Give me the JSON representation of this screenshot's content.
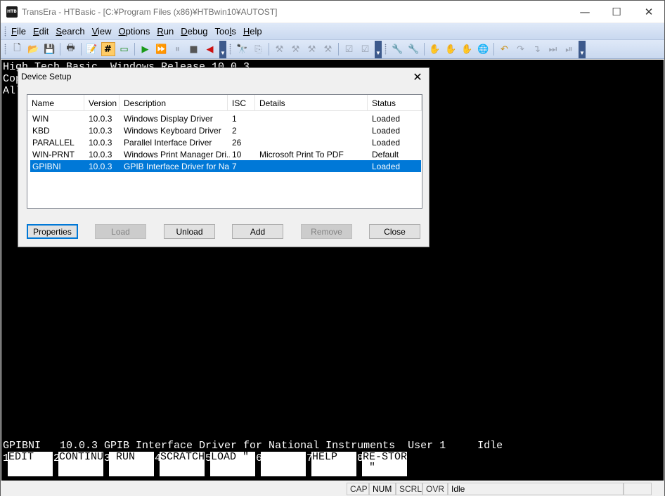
{
  "window": {
    "title": "TransEra - HTBasic - [C:¥Program Files (x86)¥HTBwin10¥AUTOST]",
    "app_icon_text": "HTB"
  },
  "menu": [
    {
      "label": "File",
      "ul": "F",
      "rest": "ile"
    },
    {
      "label": "Edit",
      "ul": "E",
      "rest": "dit"
    },
    {
      "label": "Search",
      "ul": "S",
      "rest": "earch"
    },
    {
      "label": "View",
      "ul": "V",
      "rest": "iew"
    },
    {
      "label": "Options",
      "ul": "O",
      "rest": "ptions"
    },
    {
      "label": "Run",
      "ul": "R",
      "rest": "un"
    },
    {
      "label": "Debug",
      "ul": "D",
      "rest": "ebug"
    },
    {
      "label": "Tools",
      "pre": "Too",
      "ul": "l",
      "rest": "s"
    },
    {
      "label": "Help",
      "ul": "H",
      "rest": "elp"
    }
  ],
  "toolbar": {
    "group1": [
      {
        "name": "new-file-icon",
        "glyph": "🗋",
        "color": "#444444"
      },
      {
        "name": "open-folder-icon",
        "glyph": "📂",
        "color": "#c8901a"
      },
      {
        "name": "save-icon",
        "glyph": "💾",
        "color": "#2b4fa0"
      },
      {
        "name": "print-icon",
        "glyph": "🖶",
        "color": "#444444"
      },
      {
        "name": "edit-program-icon",
        "glyph": "📝",
        "color": "#444444"
      },
      {
        "name": "hash-toggle-icon",
        "glyph": "#",
        "color": "#000000",
        "active": true
      },
      {
        "name": "console-icon",
        "glyph": "▭",
        "color": "#1a8a1a"
      },
      {
        "name": "run-icon",
        "glyph": "▶",
        "color": "#1a9a1a"
      },
      {
        "name": "continue-icon",
        "glyph": "⏩",
        "color": "#9aa3b2"
      },
      {
        "name": "pause-icon",
        "glyph": "⏸",
        "color": "#9aa3b2"
      },
      {
        "name": "stop-icon",
        "glyph": "■",
        "color": "#555555"
      },
      {
        "name": "step-back-icon",
        "glyph": "◀",
        "color": "#cc1111"
      }
    ],
    "group2": [
      {
        "name": "find-icon",
        "glyph": "🔭",
        "color": "#9aa3b2"
      },
      {
        "name": "replace-icon",
        "glyph": "⎘",
        "color": "#9aa3b2"
      },
      {
        "name": "tool-1-icon",
        "glyph": "⚒",
        "color": "#9aa3b2"
      },
      {
        "name": "tool-2-icon",
        "glyph": "⚒",
        "color": "#9aa3b2"
      },
      {
        "name": "tool-3-icon",
        "glyph": "⚒",
        "color": "#9aa3b2"
      },
      {
        "name": "tool-4-icon",
        "glyph": "⚒",
        "color": "#9aa3b2"
      },
      {
        "name": "check-1-icon",
        "glyph": "☑",
        "color": "#9aa3b2"
      },
      {
        "name": "check-2-icon",
        "glyph": "☑",
        "color": "#9aa3b2"
      }
    ],
    "group3": [
      {
        "name": "wrench-icon",
        "glyph": "🔧",
        "color": "#1a8a1a"
      },
      {
        "name": "wrench-dim-icon",
        "glyph": "🔧",
        "color": "#9aa3b2"
      },
      {
        "name": "hand-icon",
        "glyph": "✋",
        "color": "#9aa3b2"
      },
      {
        "name": "hand-x-icon",
        "glyph": "✋",
        "color": "#9aa3b2"
      },
      {
        "name": "hand-2-icon",
        "glyph": "✋",
        "color": "#9aa3b2"
      },
      {
        "name": "globe-icon",
        "glyph": "🌐",
        "color": "#c8901a"
      },
      {
        "name": "undo-icon",
        "glyph": "↶",
        "color": "#c8901a"
      },
      {
        "name": "redo-icon",
        "glyph": "↷",
        "color": "#9aa3b2"
      },
      {
        "name": "step-into-icon",
        "glyph": "↴",
        "color": "#9aa3b2"
      },
      {
        "name": "step-over-icon",
        "glyph": "⏭",
        "color": "#9aa3b2"
      },
      {
        "name": "step-out-icon",
        "glyph": "⏯",
        "color": "#9aa3b2"
      }
    ]
  },
  "console": {
    "lines": [
      "High Tech Basic  Windows Release 10.0.3",
      "Cop",
      "All"
    ],
    "status_line": "GPIBNI   10.0.3 GPIB Interface Driver for National Instruments  User 1     Idle",
    "softkeys": [
      {
        "num": "1",
        "label": "EDIT"
      },
      {
        "num": "2",
        "label": "CONTINUE"
      },
      {
        "num": "3",
        "label": " RUN"
      },
      {
        "num": "4",
        "label": "SCRATCH"
      },
      {
        "num": "5",
        "label": "LOAD \""
      },
      {
        "num": "6",
        "label": ""
      },
      {
        "num": "7",
        "label": "HELP"
      },
      {
        "num": "8",
        "label": "RE-STORE\n \""
      }
    ]
  },
  "statusbar": {
    "cap": "CAP",
    "num": "NUM",
    "scrl": "SCRL",
    "ovr": "OVR",
    "state": "Idle"
  },
  "dialog": {
    "title": "Device Setup",
    "columns": [
      "Name",
      "Version",
      "Description",
      "ISC",
      "Details",
      "Status"
    ],
    "rows": [
      {
        "name": "WIN",
        "version": "10.0.3",
        "description": "Windows Display Driver",
        "isc": "1",
        "details": "",
        "status": "Loaded"
      },
      {
        "name": "KBD",
        "version": "10.0.3",
        "description": "Windows Keyboard Driver",
        "isc": "2",
        "details": "",
        "status": "Loaded"
      },
      {
        "name": "PARALLEL",
        "version": "10.0.3",
        "description": "Parallel Interface Driver",
        "isc": "26",
        "details": "",
        "status": "Loaded"
      },
      {
        "name": "WIN-PRNT",
        "version": "10.0.3",
        "description": "Windows Print Manager Dri...",
        "isc": "10",
        "details": "Microsoft Print To PDF",
        "status": "Default"
      },
      {
        "name": "GPIBNI",
        "version": "10.0.3",
        "description": "GPIB Interface Driver for Na...",
        "isc": "7",
        "details": "",
        "status": "Loaded",
        "selected": true
      }
    ],
    "buttons": {
      "properties": "Properties",
      "load": "Load",
      "unload": "Unload",
      "add": "Add",
      "remove": "Remove",
      "close": "Close"
    }
  }
}
